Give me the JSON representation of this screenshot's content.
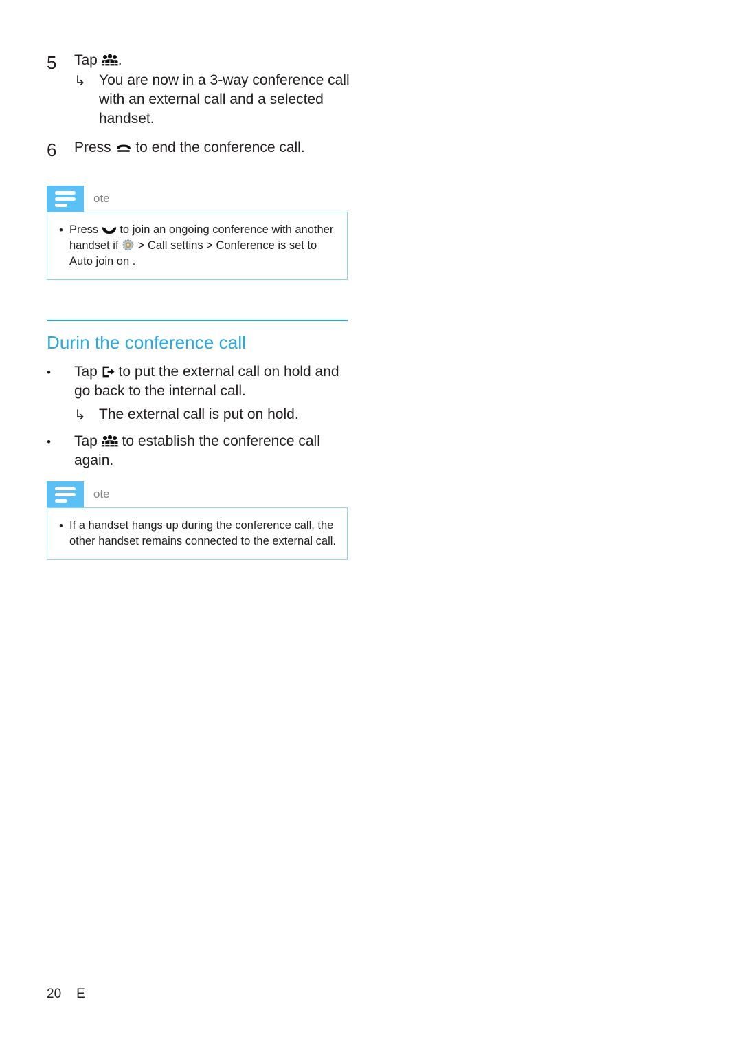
{
  "document": {
    "steps": [
      {
        "number": "5",
        "text_before_icon": "Tap ",
        "icon": "group-conference-icon",
        "text_after_icon": ".",
        "sublines": [
          {
            "arrow": "↳",
            "text": "You are now in a 3-way conference call with an external call and a selected handset."
          }
        ]
      },
      {
        "number": "6",
        "text_before_icon": "Press ",
        "icon": "hangup-icon",
        "text_after_icon": " to end the conference call.",
        "sublines": []
      }
    ],
    "note_one": {
      "title": "ote",
      "icon": "note-lines-icon",
      "bullet": "•",
      "text_part1": "Press ",
      "icon1": "talk-icon",
      "text_part2": " to join an ongoing conference with another handset if ",
      "icon2": "gear-icon",
      "text_part3": " > Call settins  > Conference  is set to Auto join on ."
    },
    "section": {
      "title": "Durin the conference call",
      "bullets": [
        {
          "bullet": "•",
          "text_before_icon": "Tap ",
          "icon": "transfer-exit-icon",
          "text_after_icon": " to put the external call on hold and go back to the internal call.",
          "sublines": [
            {
              "arrow": "↳",
              "text": "The external call is put on hold."
            }
          ]
        },
        {
          "bullet": "•",
          "text_before_icon": "Tap ",
          "icon": "group-conference-icon",
          "text_after_icon": " to establish the conference call again.",
          "sublines": []
        }
      ]
    },
    "note_two": {
      "title": "ote",
      "icon": "note-lines-icon",
      "bullet": "•",
      "text": "If a handset hangs up during the conference call, the other handset remains connected to the external call."
    },
    "footer": {
      "page_number": "20",
      "language_code": "E"
    },
    "colors": {
      "accent_blue": "#29a9e1",
      "note_badge_blue": "#5bc0f5",
      "note_border_blue": "#8fd4f5",
      "body_text": "#231f20",
      "note_title_gray": "#808285"
    }
  }
}
